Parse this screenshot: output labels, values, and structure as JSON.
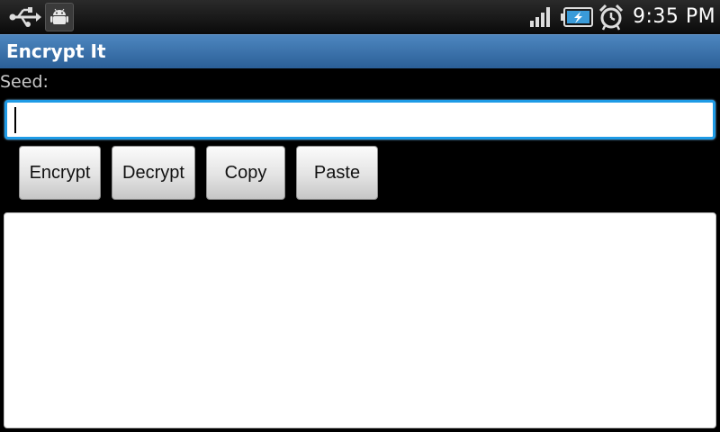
{
  "status_bar": {
    "time": "9:35 PM",
    "icons": [
      "usb-icon",
      "android-debug-icon",
      "signal-icon",
      "battery-charging-icon",
      "alarm-clock-icon"
    ]
  },
  "app": {
    "title": "Encrypt It"
  },
  "form": {
    "seed_label": "Seed:",
    "seed_value": "",
    "buttons": {
      "encrypt": "Encrypt",
      "decrypt": "Decrypt",
      "copy": "Copy",
      "paste": "Paste"
    },
    "output_value": ""
  },
  "colors": {
    "title_bar": "#2b5f97",
    "focus_border": "#1e9be6",
    "background": "#000000"
  }
}
